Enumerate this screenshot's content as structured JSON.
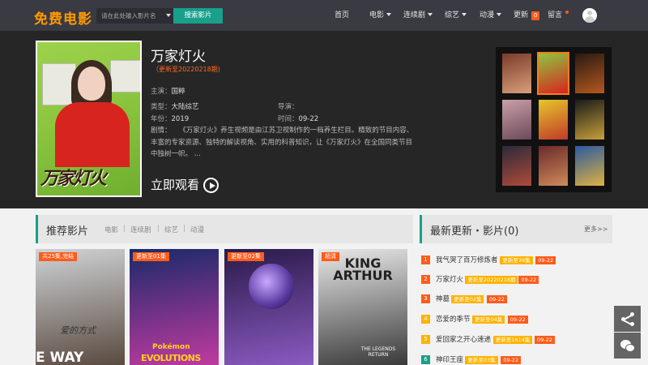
{
  "header": {
    "logo": "免费电影",
    "search_placeholder": "请在此处输入影片名",
    "search_button": "搜索影片",
    "nav": [
      {
        "label": "首页"
      },
      {
        "label": "电影"
      },
      {
        "label": "连续剧"
      },
      {
        "label": "综艺"
      },
      {
        "label": "动漫"
      },
      {
        "label": "更新",
        "badge": "0"
      },
      {
        "label": "留言"
      }
    ]
  },
  "featured": {
    "title": "万家灯火",
    "update": "（更新至20220218期)",
    "poster_text": "万家灯火",
    "cast_label": "主演：",
    "cast": "国粹",
    "type_label": "类型：",
    "type": "大陆综艺",
    "director_label": "导演：",
    "director": "",
    "year_label": "年份：",
    "year": "2019",
    "time_label": "时间：",
    "time": "09-22",
    "desc_label": "剧情：",
    "desc": "《万家灯火》养生视频是由江苏卫视制作的一档养生栏目。精致的节目内容、丰富的专家资源、独特的解读视角、实用的科普知识，让《万家灯火》在全国同类节目中独树一帜。 ...",
    "watch_label": "立即观看"
  },
  "thumbs": [
    {
      "colors": [
        "#7a3a2a",
        "#d9a07a"
      ]
    },
    {
      "colors": [
        "#8cc63f",
        "#d8241f"
      ]
    },
    {
      "colors": [
        "#2a1a12",
        "#b5581e"
      ]
    },
    {
      "colors": [
        "#c9a0a8",
        "#6b4a58"
      ]
    },
    {
      "colors": [
        "#e6c62a",
        "#c23a2a"
      ]
    },
    {
      "colors": [
        "#1a1a1a",
        "#c8a03a"
      ]
    },
    {
      "colors": [
        "#2a2a3a",
        "#b04a3a"
      ]
    },
    {
      "colors": [
        "#6a2a2a",
        "#d08a5a"
      ]
    },
    {
      "colors": [
        "#2a5aa0",
        "#e0b040"
      ]
    }
  ],
  "recommend": {
    "title": "推荐影片",
    "tabs": [
      "电影",
      "连续剧",
      "综艺",
      "动漫"
    ],
    "cards": [
      {
        "badge": "共25集,完结",
        "overlay": "爱的方式",
        "sub": "E WAY",
        "colors": [
          "#cfd3d6",
          "#5a4a40"
        ]
      },
      {
        "badge": "更新至01集",
        "overlay": "EVOLUTIONS",
        "sub": "Pokémon",
        "colors": [
          "#1a2a6a",
          "#c03aa0"
        ]
      },
      {
        "badge": "更新至02集",
        "overlay": "",
        "sub": "",
        "colors": [
          "#2a1a4a",
          "#8a5ac0"
        ]
      },
      {
        "badge": "超清",
        "overlay": "KING ARTHUR",
        "sub": "THE LEGENDS RETURN",
        "colors": [
          "#e8e8e8",
          "#3a3a3a"
        ]
      }
    ]
  },
  "latest": {
    "title": "最新更新・影片(0)",
    "more": "更多>>",
    "items": [
      {
        "num": "1",
        "name": "我气哭了百万修炼者",
        "tag": "更新至39集",
        "date": "09-22",
        "color": "#ff5c1b"
      },
      {
        "num": "2",
        "name": "万家灯火",
        "tag": "更新至20220218期",
        "date": "09-22",
        "color": "#ff5c1b"
      },
      {
        "num": "3",
        "name": "神墓",
        "tag": "更新至02集",
        "date": "09-22",
        "color": "#ff5c1b"
      },
      {
        "num": "4",
        "name": "恋爱的季节",
        "tag": "更新至04集",
        "date": "09-22",
        "color": "#ffb300"
      },
      {
        "num": "5",
        "name": "爱回家之开心速递",
        "tag": "更新至1614集",
        "date": "09-22",
        "color": "#ffb300"
      },
      {
        "num": "6",
        "name": "神印王座",
        "tag": "更新至03集",
        "date": "09-22",
        "color": "#18a08b"
      }
    ]
  },
  "colors": {
    "accent": "#18a08b",
    "orange": "#ff5c1b",
    "yellow": "#ffb300",
    "logo": "#ff9900"
  }
}
